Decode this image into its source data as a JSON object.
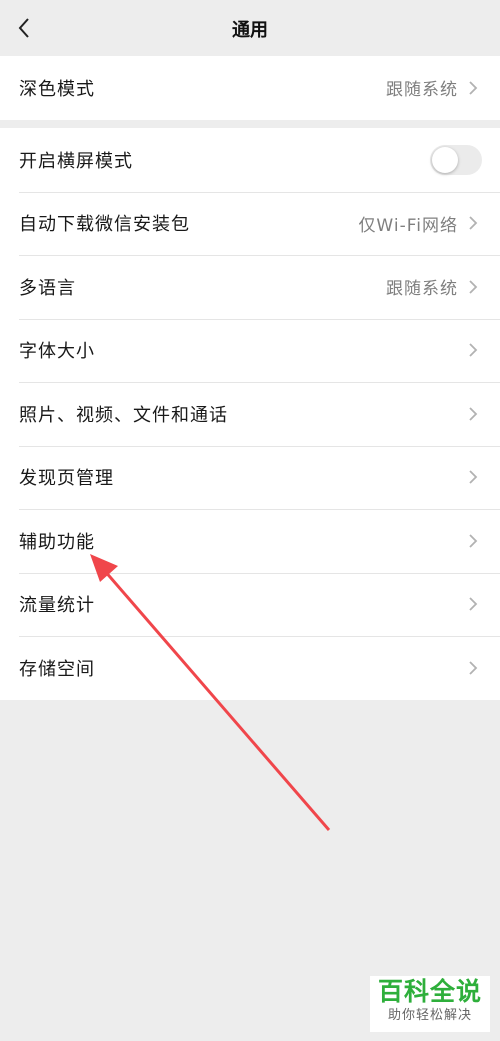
{
  "nav": {
    "title": "通用"
  },
  "group1": [
    {
      "label": "深色模式",
      "value": "跟随系统"
    }
  ],
  "group2": {
    "landscape": {
      "label": "开启横屏模式",
      "enabled": false
    },
    "auto_download": {
      "label": "自动下载微信安装包",
      "value": "仅Wi-Fi网络"
    },
    "language": {
      "label": "多语言",
      "value": "跟随系统"
    },
    "font_size": {
      "label": "字体大小"
    },
    "media": {
      "label": "照片、视频、文件和通话"
    },
    "discover": {
      "label": "发现页管理"
    },
    "accessibility": {
      "label": "辅助功能"
    },
    "traffic": {
      "label": "流量统计"
    },
    "storage": {
      "label": "存储空间"
    }
  },
  "watermark": {
    "brand": "百科全说",
    "subtitle": "助你轻松解决"
  },
  "colors": {
    "background": "#ededed",
    "annotation_arrow": "#f0464b",
    "watermark_brand": "#2eaf3b"
  }
}
